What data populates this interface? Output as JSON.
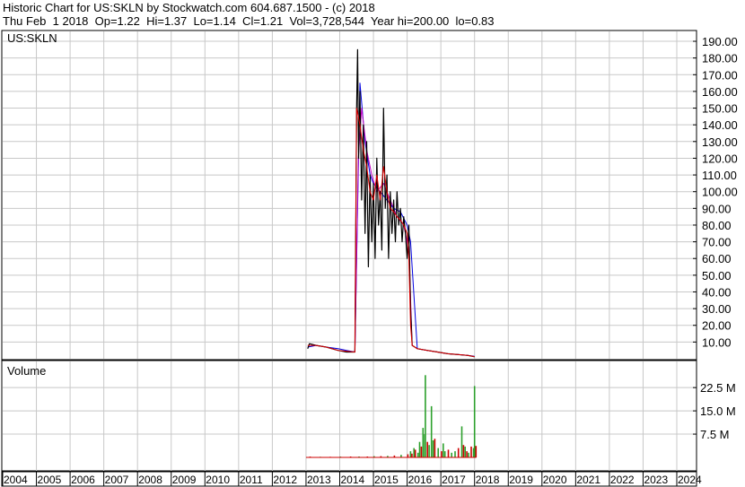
{
  "header": {
    "line1": "Historic Chart for US:SKLN by Stockwatch.com 604.687.1500 - (c) 2018",
    "line2": "Thu Feb  1 2018  Op=1.22  Hi=1.37  Lo=1.14  Cl=1.21  Vol=3,728,544  Year hi=200.00  lo=0.83"
  },
  "colors": {
    "price_line": "#000000",
    "moving_avg_short": "#e00000",
    "moving_avg_long": "#0000e0",
    "moving_avg_mid": "#c000c0",
    "volume_up": "#2ca02c",
    "volume_down": "#cc0000",
    "grid": "#c8c8c8"
  },
  "chart_data": [
    {
      "type": "line",
      "title": "US:SKLN",
      "x_unit": "year",
      "ylim": [
        0,
        200
      ],
      "y_ticks": [
        "10.00",
        "20.00",
        "30.00",
        "40.00",
        "50.00",
        "60.00",
        "70.00",
        "80.00",
        "90.00",
        "100.00",
        "110.00",
        "120.00",
        "130.00",
        "140.00",
        "150.00",
        "160.00",
        "170.00",
        "180.00",
        "190.00"
      ],
      "grid": true,
      "series": [
        {
          "role": "price",
          "x": [
            2013.05,
            2013.1,
            2013.3,
            2013.6,
            2013.95,
            2014.2,
            2014.45,
            2014.5,
            2014.53,
            2014.56,
            2014.6,
            2014.65,
            2014.7,
            2014.75,
            2014.8,
            2014.85,
            2014.9,
            2014.95,
            2015.0,
            2015.05,
            2015.1,
            2015.15,
            2015.2,
            2015.25,
            2015.3,
            2015.35,
            2015.4,
            2015.45,
            2015.5,
            2015.55,
            2015.6,
            2015.65,
            2015.7,
            2015.75,
            2015.8,
            2015.85,
            2015.9,
            2015.95,
            2016.0,
            2016.05,
            2016.1,
            2016.15,
            2016.3,
            2016.6,
            2016.9,
            2017.2,
            2017.5,
            2017.8,
            2018.0
          ],
          "values": [
            6,
            9,
            8,
            7,
            5,
            4,
            4,
            150,
            185,
            120,
            160,
            95,
            140,
            75,
            130,
            55,
            110,
            70,
            105,
            60,
            120,
            80,
            100,
            65,
            150,
            90,
            110,
            60,
            100,
            75,
            95,
            70,
            100,
            80,
            90,
            70,
            85,
            75,
            60,
            80,
            30,
            8,
            6,
            5,
            4,
            3,
            2.5,
            2,
            1.2
          ]
        },
        {
          "role": "moving-average-short",
          "x": [
            2013.05,
            2013.3,
            2013.6,
            2013.95,
            2014.2,
            2014.45,
            2014.5,
            2014.6,
            2014.7,
            2014.8,
            2014.9,
            2015.0,
            2015.1,
            2015.2,
            2015.3,
            2015.4,
            2015.5,
            2015.6,
            2015.7,
            2015.8,
            2015.9,
            2016.0,
            2016.05,
            2016.1,
            2016.15,
            2016.3,
            2016.6,
            2016.9,
            2017.2,
            2017.5,
            2017.8,
            2018.0
          ],
          "values": [
            8,
            8,
            7,
            5,
            4.5,
            4,
            150,
            140,
            125,
            115,
            100,
            95,
            110,
            95,
            115,
            100,
            90,
            88,
            85,
            83,
            80,
            75,
            60,
            20,
            8,
            6,
            5,
            4,
            3,
            2.5,
            2,
            1.3
          ]
        },
        {
          "role": "moving-average-long",
          "x": [
            2013.05,
            2013.3,
            2013.6,
            2013.95,
            2014.2,
            2014.45,
            2014.6,
            2014.75,
            2014.9,
            2015.0,
            2015.2,
            2015.4,
            2015.6,
            2015.8,
            2016.0,
            2016.1,
            2016.3,
            2016.6,
            2016.9,
            2017.2,
            2017.5,
            2017.8,
            2018.0
          ],
          "values": [
            7,
            8,
            7,
            6,
            5,
            4,
            165,
            130,
            110,
            105,
            100,
            95,
            90,
            88,
            80,
            70,
            6,
            5,
            4,
            3,
            2.5,
            2,
            1.5
          ]
        },
        {
          "role": "moving-average-mid",
          "x": [
            2014.45,
            2014.55,
            2014.65,
            2014.8,
            2014.95,
            2015.1,
            2015.3,
            2015.5,
            2015.7,
            2015.9,
            2016.05,
            2016.15
          ],
          "values": [
            4,
            120,
            150,
            125,
            110,
            100,
            105,
            95,
            85,
            80,
            65,
            8
          ]
        }
      ]
    },
    {
      "type": "bar",
      "title": "Volume",
      "ylim": [
        0,
        30000000
      ],
      "y_ticks": [
        "7.5 M",
        "15.0 M",
        "22.5 M"
      ],
      "grid": true,
      "bars": [
        {
          "x": 2013.1,
          "v": 0.25,
          "up": false
        },
        {
          "x": 2013.4,
          "v": 0.2,
          "up": true
        },
        {
          "x": 2013.7,
          "v": 0.2,
          "up": false
        },
        {
          "x": 2014.0,
          "v": 0.25,
          "up": true
        },
        {
          "x": 2014.3,
          "v": 0.3,
          "up": false
        },
        {
          "x": 2014.55,
          "v": 0.3,
          "up": true
        },
        {
          "x": 2014.8,
          "v": 0.3,
          "up": false
        },
        {
          "x": 2015.0,
          "v": 0.4,
          "up": true
        },
        {
          "x": 2015.2,
          "v": 0.4,
          "up": false
        },
        {
          "x": 2015.4,
          "v": 0.5,
          "up": true
        },
        {
          "x": 2015.6,
          "v": 0.6,
          "up": false
        },
        {
          "x": 2015.8,
          "v": 0.8,
          "up": true
        },
        {
          "x": 2016.0,
          "v": 1.0,
          "up": false
        },
        {
          "x": 2016.08,
          "v": 2.0,
          "up": true
        },
        {
          "x": 2016.12,
          "v": 1.2,
          "up": false
        },
        {
          "x": 2016.18,
          "v": 3.0,
          "up": true
        },
        {
          "x": 2016.22,
          "v": 2.5,
          "up": false
        },
        {
          "x": 2016.3,
          "v": 1.5,
          "up": true
        },
        {
          "x": 2016.35,
          "v": 5.0,
          "up": true
        },
        {
          "x": 2016.4,
          "v": 3.5,
          "up": false
        },
        {
          "x": 2016.45,
          "v": 9.5,
          "up": true
        },
        {
          "x": 2016.5,
          "v": 7.5,
          "up": true
        },
        {
          "x": 2016.52,
          "v": 26.5,
          "up": true
        },
        {
          "x": 2016.58,
          "v": 5.0,
          "up": false
        },
        {
          "x": 2016.63,
          "v": 4.0,
          "up": true
        },
        {
          "x": 2016.7,
          "v": 16.5,
          "up": true
        },
        {
          "x": 2016.75,
          "v": 5.5,
          "up": true
        },
        {
          "x": 2016.8,
          "v": 6.0,
          "up": false
        },
        {
          "x": 2016.9,
          "v": 3.0,
          "up": true
        },
        {
          "x": 2017.0,
          "v": 2.0,
          "up": false
        },
        {
          "x": 2017.05,
          "v": 4.5,
          "up": true
        },
        {
          "x": 2017.1,
          "v": 2.0,
          "up": true
        },
        {
          "x": 2017.2,
          "v": 2.5,
          "up": false
        },
        {
          "x": 2017.3,
          "v": 1.5,
          "up": true
        },
        {
          "x": 2017.4,
          "v": 2.0,
          "up": true
        },
        {
          "x": 2017.5,
          "v": 3.0,
          "up": false
        },
        {
          "x": 2017.6,
          "v": 10.0,
          "up": true
        },
        {
          "x": 2017.65,
          "v": 4.0,
          "up": false
        },
        {
          "x": 2017.7,
          "v": 3.5,
          "up": true
        },
        {
          "x": 2017.75,
          "v": 2.0,
          "up": false
        },
        {
          "x": 2017.8,
          "v": 1.5,
          "up": true
        },
        {
          "x": 2017.88,
          "v": 3.5,
          "up": false
        },
        {
          "x": 2017.95,
          "v": 3.0,
          "up": true
        },
        {
          "x": 2017.98,
          "v": 23.0,
          "up": true
        },
        {
          "x": 2018.02,
          "v": 3.7,
          "up": false
        }
      ]
    }
  ],
  "x_axis": {
    "labels": [
      "2004",
      "2005",
      "2006",
      "2007",
      "2008",
      "2009",
      "2010",
      "2011",
      "2012",
      "2013",
      "2014",
      "2015",
      "2016",
      "2017",
      "2018",
      "2019",
      "2020",
      "2021",
      "2022",
      "2023",
      "2024"
    ]
  }
}
